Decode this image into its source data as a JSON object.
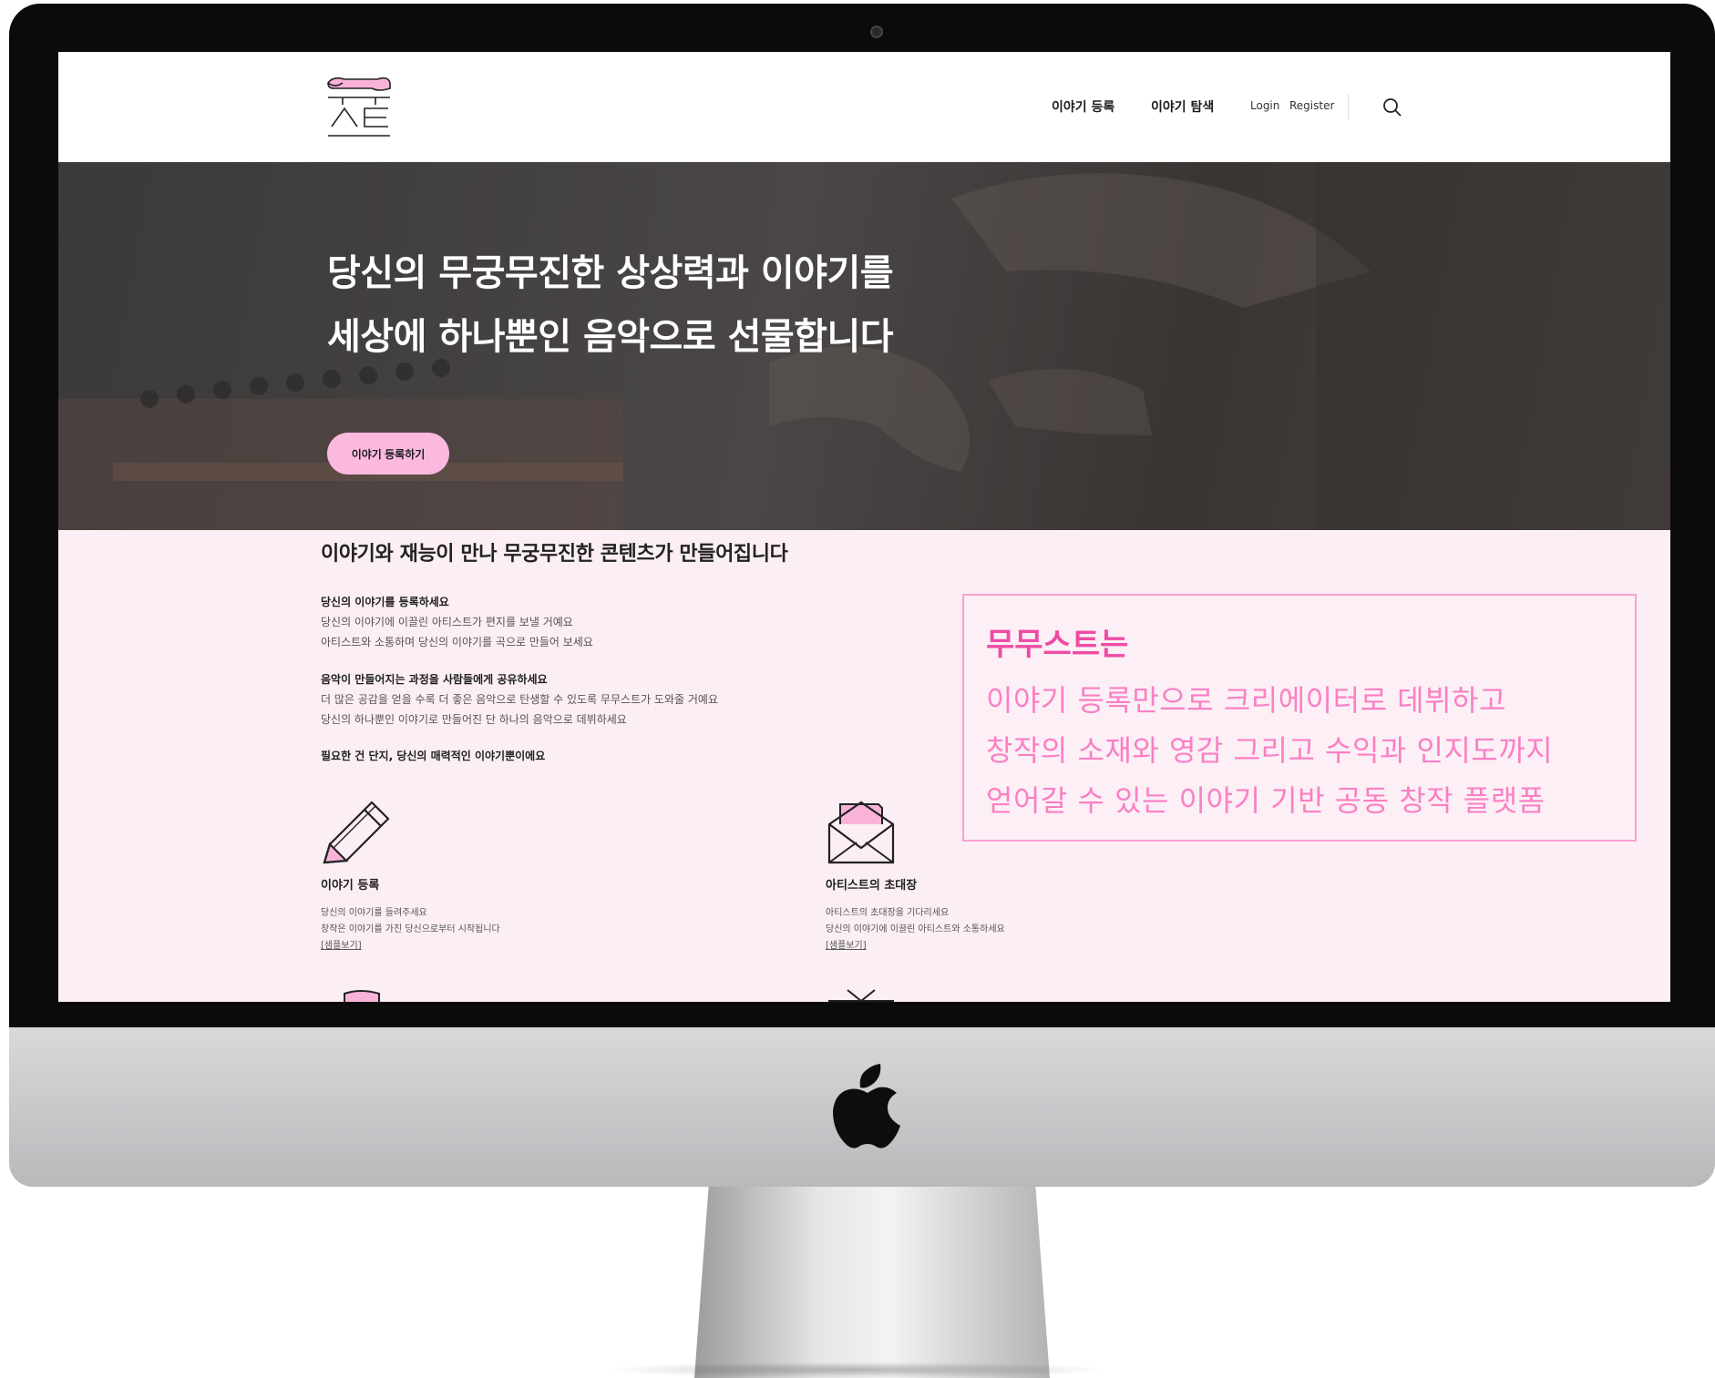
{
  "header": {
    "nav": [
      {
        "label": "이야기 등록"
      },
      {
        "label": "이야기 탐색"
      }
    ],
    "auth": {
      "login": "Login",
      "register": "Register"
    }
  },
  "hero": {
    "title_line1": "당신의 무궁무진한 상상력과 이야기를",
    "title_line2": "세상에 하나뿐인 음악으로 선물합니다",
    "cta": "이야기 등록하기"
  },
  "intro": {
    "title": "이야기와 재능이 만나 무궁무진한 콘텐츠가 만들어집니다",
    "blocks": [
      {
        "heading": "당신의 이야기를 등록하세요",
        "lines": [
          "당신의 이야기에 이끌린 아티스트가 편지를 보낼 거예요",
          "아티스트와 소통하며 당신의 이야기를 곡으로 만들어 보세요"
        ]
      },
      {
        "heading": "음악이 만들어지는 과정을 사람들에게 공유하세요",
        "lines": [
          "더 많은 공감을 얻을 수록 더 좋은 음악으로 탄생할 수 있도록 무무스트가 도와줄 거예요",
          "당신의 하나뿐인 이야기로 만들어진 단 하나의 음악으로 데뷔하세요"
        ]
      },
      {
        "heading": "필요한 건 단지, 당신의 매력적인 이야기뿐이에요",
        "lines": []
      }
    ]
  },
  "promo": {
    "heading": "무무스트는",
    "lines": [
      "이야기 등록만으로 크리에이터로 데뷔하고",
      "창작의 소재와 영감 그리고 수익과 인지도까지",
      "얻어갈 수 있는 이야기 기반 공동 창작 플랫폼"
    ]
  },
  "cards": [
    {
      "title": "이야기 등록",
      "desc1": "당신의 이야기를 들려주세요",
      "desc2": "창작은 이야기를 가진 당신으로부터 시작됩니다",
      "link": "[샘플보기]",
      "icon": "pencil-icon"
    },
    {
      "title": "아티스트의 초대장",
      "desc1": "아티스트의 초대장을 기다리세요",
      "desc2": "당신의 이야기에 이끌린 아티스트와 소통하세요",
      "link": "[샘플보기]",
      "icon": "envelope-icon"
    }
  ],
  "colors": {
    "accent": "#fbb9e0",
    "promo_text": "#fb7fc4",
    "promo_heading": "#ef4ba5",
    "section_bg": "#fbeef5"
  }
}
